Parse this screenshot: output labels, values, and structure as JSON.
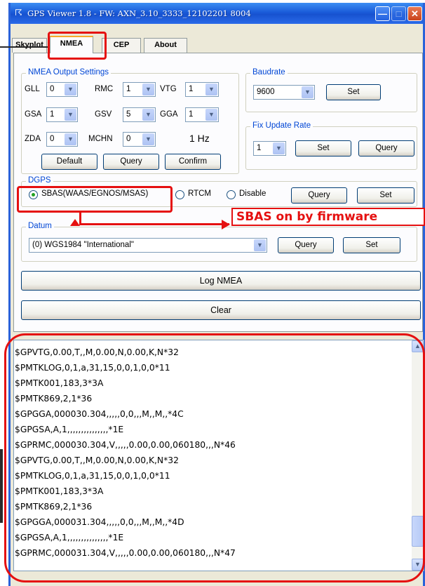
{
  "window": {
    "title": "GPS Viewer 1.8 - FW: AXN_3.10_3333_12102201 8004"
  },
  "tabs": [
    {
      "label": "Skyplot"
    },
    {
      "label": "NMEA"
    },
    {
      "label": "CEP"
    },
    {
      "label": "About"
    }
  ],
  "nmea_output": {
    "title": "NMEA Output Settings",
    "gll": {
      "label": "GLL",
      "value": "0"
    },
    "rmc": {
      "label": "RMC",
      "value": "1"
    },
    "vtg": {
      "label": "VTG",
      "value": "1"
    },
    "gsa": {
      "label": "GSA",
      "value": "1"
    },
    "gsv": {
      "label": "GSV",
      "value": "5"
    },
    "gga": {
      "label": "GGA",
      "value": "1"
    },
    "zda": {
      "label": "ZDA",
      "value": "0"
    },
    "mchn": {
      "label": "MCHN",
      "value": "0"
    },
    "rate_text": "1 Hz",
    "default_label": "Default",
    "query_label": "Query",
    "confirm_label": "Confirm"
  },
  "baudrate": {
    "title": "Baudrate",
    "value": "9600",
    "set_label": "Set"
  },
  "fix_rate": {
    "title": "Fix Update Rate",
    "value": "1",
    "set_label": "Set",
    "query_label": "Query"
  },
  "dgps": {
    "title": "DGPS",
    "sbas_label": "SBAS(WAAS/EGNOS/MSAS)",
    "rtcm_label": "RTCM",
    "disable_label": "Disable",
    "query_label": "Query",
    "set_label": "Set",
    "selected": "sbas"
  },
  "annotation": {
    "text": "SBAS on by firmware",
    "color": "#e51010"
  },
  "datum": {
    "title": "Datum",
    "value": "(0) WGS1984 \"International\"",
    "query_label": "Query",
    "set_label": "Set"
  },
  "log_nmea_label": "Log NMEA",
  "clear_label": "Clear",
  "log_lines": [
    "$GPVTG,0.00,T,,M,0.00,N,0.00,K,N*32",
    "$PMTKLOG,0,1,a,31,15,0,0,1,0,0*11",
    "$PMTK001,183,3*3A",
    "$PMTK869,2,1*36",
    "$GPGGA,000030.304,,,,,0,0,,,M,,M,,*4C",
    "$GPGSA,A,1,,,,,,,,,,,,,,,*1E",
    "$GPRMC,000030.304,V,,,,,0.00,0.00,060180,,,N*46",
    "$GPVTG,0.00,T,,M,0.00,N,0.00,K,N*32",
    "$PMTKLOG,0,1,a,31,15,0,0,1,0,0*11",
    "$PMTK001,183,3*3A",
    "$PMTK869,2,1*36",
    "$GPGGA,000031.304,,,,,0,0,,,M,,M,,*4D",
    "$GPGSA,A,1,,,,,,,,,,,,,,,*1E",
    "$GPRMC,000031.304,V,,,,,0.00,0.00,060180,,,N*47"
  ],
  "colors": {
    "title_bar": "#1a5bd9",
    "group_label": "#0046d5",
    "highlight": "#e51010",
    "active_tab": "#f5ab2b"
  }
}
